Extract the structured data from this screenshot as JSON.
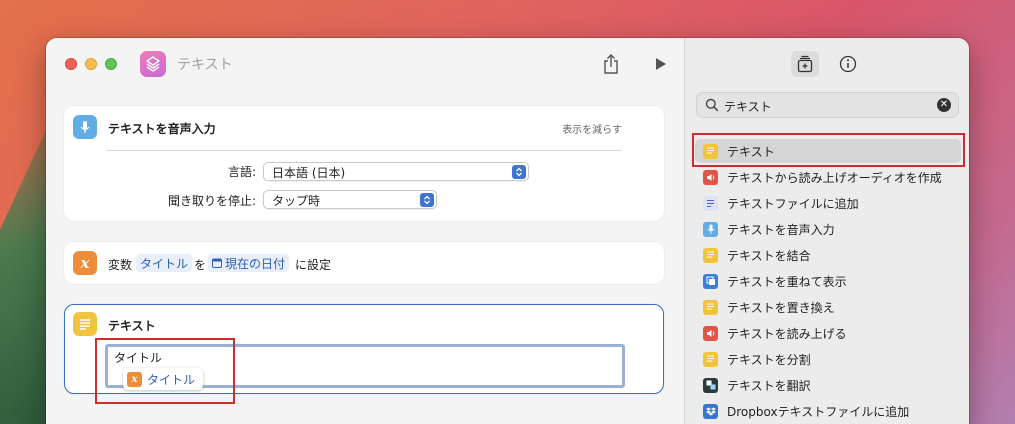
{
  "window": {
    "title": "テキスト"
  },
  "actions": {
    "dictate": {
      "title": "テキストを音声入力",
      "show_less": "表示を減らす",
      "language_label": "言語:",
      "language_value": "日本語 (日本)",
      "stop_label": "聞き取りを停止:",
      "stop_value": "タップ時"
    },
    "set_variable": {
      "prefix": "変数",
      "variable": "タイトル",
      "to": "を",
      "value": "現在の日付",
      "suffix": "に設定"
    },
    "text": {
      "title": "テキスト",
      "content": "タイトル",
      "chip": "タイトル"
    }
  },
  "library": {
    "search_value": "テキスト",
    "items": [
      {
        "label": "テキスト",
        "icon": "text-icon",
        "selected": true
      },
      {
        "label": "テキストから読み上げオーディオを作成",
        "icon": "speaker-icon"
      },
      {
        "label": "テキストファイルに追加",
        "icon": "file-append-icon"
      },
      {
        "label": "テキストを音声入力",
        "icon": "microphone-icon"
      },
      {
        "label": "テキストを結合",
        "icon": "text-icon"
      },
      {
        "label": "テキストを重ねて表示",
        "icon": "overlay-icon"
      },
      {
        "label": "テキストを置き換え",
        "icon": "text-icon"
      },
      {
        "label": "テキストを読み上げる",
        "icon": "speaker-icon"
      },
      {
        "label": "テキストを分割",
        "icon": "text-icon"
      },
      {
        "label": "テキストを翻訳",
        "icon": "translate-icon"
      },
      {
        "label": "Dropboxテキストファイルに追加",
        "icon": "dropbox-icon"
      }
    ]
  },
  "colors": {
    "accent": "#3b6fc2",
    "highlight": "#c9302c"
  }
}
